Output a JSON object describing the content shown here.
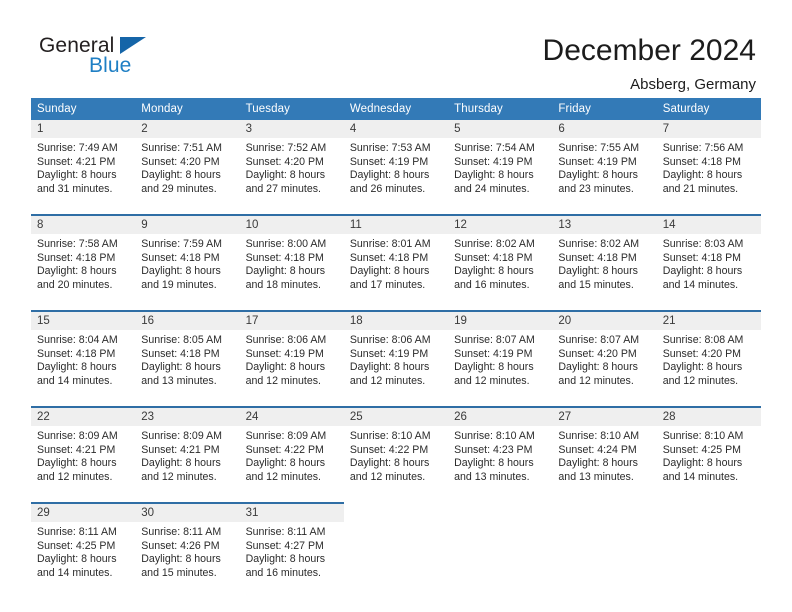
{
  "brand": {
    "name_part1": "General",
    "name_part2": "Blue",
    "triangle_icon": "triangle-icon",
    "color_dark": "#231f20",
    "color_blue": "#1f7fc4",
    "triangle_color": "#1565a8"
  },
  "header": {
    "title": "December 2024",
    "subtitle": "Absberg, Germany"
  },
  "theme": {
    "header_bg": "#337ab7",
    "header_text": "#ffffff",
    "datenum_bg": "#efefef",
    "week_divider": "#2f6ea5"
  },
  "calendar": {
    "weekday_headers": [
      "Sunday",
      "Monday",
      "Tuesday",
      "Wednesday",
      "Thursday",
      "Friday",
      "Saturday"
    ],
    "weeks": [
      [
        {
          "day": "1",
          "sunrise": "Sunrise: 7:49 AM",
          "sunset": "Sunset: 4:21 PM",
          "daylight_line1": "Daylight: 8 hours",
          "daylight_line2": "and 31 minutes."
        },
        {
          "day": "2",
          "sunrise": "Sunrise: 7:51 AM",
          "sunset": "Sunset: 4:20 PM",
          "daylight_line1": "Daylight: 8 hours",
          "daylight_line2": "and 29 minutes."
        },
        {
          "day": "3",
          "sunrise": "Sunrise: 7:52 AM",
          "sunset": "Sunset: 4:20 PM",
          "daylight_line1": "Daylight: 8 hours",
          "daylight_line2": "and 27 minutes."
        },
        {
          "day": "4",
          "sunrise": "Sunrise: 7:53 AM",
          "sunset": "Sunset: 4:19 PM",
          "daylight_line1": "Daylight: 8 hours",
          "daylight_line2": "and 26 minutes."
        },
        {
          "day": "5",
          "sunrise": "Sunrise: 7:54 AM",
          "sunset": "Sunset: 4:19 PM",
          "daylight_line1": "Daylight: 8 hours",
          "daylight_line2": "and 24 minutes."
        },
        {
          "day": "6",
          "sunrise": "Sunrise: 7:55 AM",
          "sunset": "Sunset: 4:19 PM",
          "daylight_line1": "Daylight: 8 hours",
          "daylight_line2": "and 23 minutes."
        },
        {
          "day": "7",
          "sunrise": "Sunrise: 7:56 AM",
          "sunset": "Sunset: 4:18 PM",
          "daylight_line1": "Daylight: 8 hours",
          "daylight_line2": "and 21 minutes."
        }
      ],
      [
        {
          "day": "8",
          "sunrise": "Sunrise: 7:58 AM",
          "sunset": "Sunset: 4:18 PM",
          "daylight_line1": "Daylight: 8 hours",
          "daylight_line2": "and 20 minutes."
        },
        {
          "day": "9",
          "sunrise": "Sunrise: 7:59 AM",
          "sunset": "Sunset: 4:18 PM",
          "daylight_line1": "Daylight: 8 hours",
          "daylight_line2": "and 19 minutes."
        },
        {
          "day": "10",
          "sunrise": "Sunrise: 8:00 AM",
          "sunset": "Sunset: 4:18 PM",
          "daylight_line1": "Daylight: 8 hours",
          "daylight_line2": "and 18 minutes."
        },
        {
          "day": "11",
          "sunrise": "Sunrise: 8:01 AM",
          "sunset": "Sunset: 4:18 PM",
          "daylight_line1": "Daylight: 8 hours",
          "daylight_line2": "and 17 minutes."
        },
        {
          "day": "12",
          "sunrise": "Sunrise: 8:02 AM",
          "sunset": "Sunset: 4:18 PM",
          "daylight_line1": "Daylight: 8 hours",
          "daylight_line2": "and 16 minutes."
        },
        {
          "day": "13",
          "sunrise": "Sunrise: 8:02 AM",
          "sunset": "Sunset: 4:18 PM",
          "daylight_line1": "Daylight: 8 hours",
          "daylight_line2": "and 15 minutes."
        },
        {
          "day": "14",
          "sunrise": "Sunrise: 8:03 AM",
          "sunset": "Sunset: 4:18 PM",
          "daylight_line1": "Daylight: 8 hours",
          "daylight_line2": "and 14 minutes."
        }
      ],
      [
        {
          "day": "15",
          "sunrise": "Sunrise: 8:04 AM",
          "sunset": "Sunset: 4:18 PM",
          "daylight_line1": "Daylight: 8 hours",
          "daylight_line2": "and 14 minutes."
        },
        {
          "day": "16",
          "sunrise": "Sunrise: 8:05 AM",
          "sunset": "Sunset: 4:18 PM",
          "daylight_line1": "Daylight: 8 hours",
          "daylight_line2": "and 13 minutes."
        },
        {
          "day": "17",
          "sunrise": "Sunrise: 8:06 AM",
          "sunset": "Sunset: 4:19 PM",
          "daylight_line1": "Daylight: 8 hours",
          "daylight_line2": "and 12 minutes."
        },
        {
          "day": "18",
          "sunrise": "Sunrise: 8:06 AM",
          "sunset": "Sunset: 4:19 PM",
          "daylight_line1": "Daylight: 8 hours",
          "daylight_line2": "and 12 minutes."
        },
        {
          "day": "19",
          "sunrise": "Sunrise: 8:07 AM",
          "sunset": "Sunset: 4:19 PM",
          "daylight_line1": "Daylight: 8 hours",
          "daylight_line2": "and 12 minutes."
        },
        {
          "day": "20",
          "sunrise": "Sunrise: 8:07 AM",
          "sunset": "Sunset: 4:20 PM",
          "daylight_line1": "Daylight: 8 hours",
          "daylight_line2": "and 12 minutes."
        },
        {
          "day": "21",
          "sunrise": "Sunrise: 8:08 AM",
          "sunset": "Sunset: 4:20 PM",
          "daylight_line1": "Daylight: 8 hours",
          "daylight_line2": "and 12 minutes."
        }
      ],
      [
        {
          "day": "22",
          "sunrise": "Sunrise: 8:09 AM",
          "sunset": "Sunset: 4:21 PM",
          "daylight_line1": "Daylight: 8 hours",
          "daylight_line2": "and 12 minutes."
        },
        {
          "day": "23",
          "sunrise": "Sunrise: 8:09 AM",
          "sunset": "Sunset: 4:21 PM",
          "daylight_line1": "Daylight: 8 hours",
          "daylight_line2": "and 12 minutes."
        },
        {
          "day": "24",
          "sunrise": "Sunrise: 8:09 AM",
          "sunset": "Sunset: 4:22 PM",
          "daylight_line1": "Daylight: 8 hours",
          "daylight_line2": "and 12 minutes."
        },
        {
          "day": "25",
          "sunrise": "Sunrise: 8:10 AM",
          "sunset": "Sunset: 4:22 PM",
          "daylight_line1": "Daylight: 8 hours",
          "daylight_line2": "and 12 minutes."
        },
        {
          "day": "26",
          "sunrise": "Sunrise: 8:10 AM",
          "sunset": "Sunset: 4:23 PM",
          "daylight_line1": "Daylight: 8 hours",
          "daylight_line2": "and 13 minutes."
        },
        {
          "day": "27",
          "sunrise": "Sunrise: 8:10 AM",
          "sunset": "Sunset: 4:24 PM",
          "daylight_line1": "Daylight: 8 hours",
          "daylight_line2": "and 13 minutes."
        },
        {
          "day": "28",
          "sunrise": "Sunrise: 8:10 AM",
          "sunset": "Sunset: 4:25 PM",
          "daylight_line1": "Daylight: 8 hours",
          "daylight_line2": "and 14 minutes."
        }
      ],
      [
        {
          "day": "29",
          "sunrise": "Sunrise: 8:11 AM",
          "sunset": "Sunset: 4:25 PM",
          "daylight_line1": "Daylight: 8 hours",
          "daylight_line2": "and 14 minutes."
        },
        {
          "day": "30",
          "sunrise": "Sunrise: 8:11 AM",
          "sunset": "Sunset: 4:26 PM",
          "daylight_line1": "Daylight: 8 hours",
          "daylight_line2": "and 15 minutes."
        },
        {
          "day": "31",
          "sunrise": "Sunrise: 8:11 AM",
          "sunset": "Sunset: 4:27 PM",
          "daylight_line1": "Daylight: 8 hours",
          "daylight_line2": "and 16 minutes."
        },
        {
          "day": "",
          "sunrise": "",
          "sunset": "",
          "daylight_line1": "",
          "daylight_line2": ""
        },
        {
          "day": "",
          "sunrise": "",
          "sunset": "",
          "daylight_line1": "",
          "daylight_line2": ""
        },
        {
          "day": "",
          "sunrise": "",
          "sunset": "",
          "daylight_line1": "",
          "daylight_line2": ""
        },
        {
          "day": "",
          "sunrise": "",
          "sunset": "",
          "daylight_line1": "",
          "daylight_line2": ""
        }
      ]
    ]
  }
}
